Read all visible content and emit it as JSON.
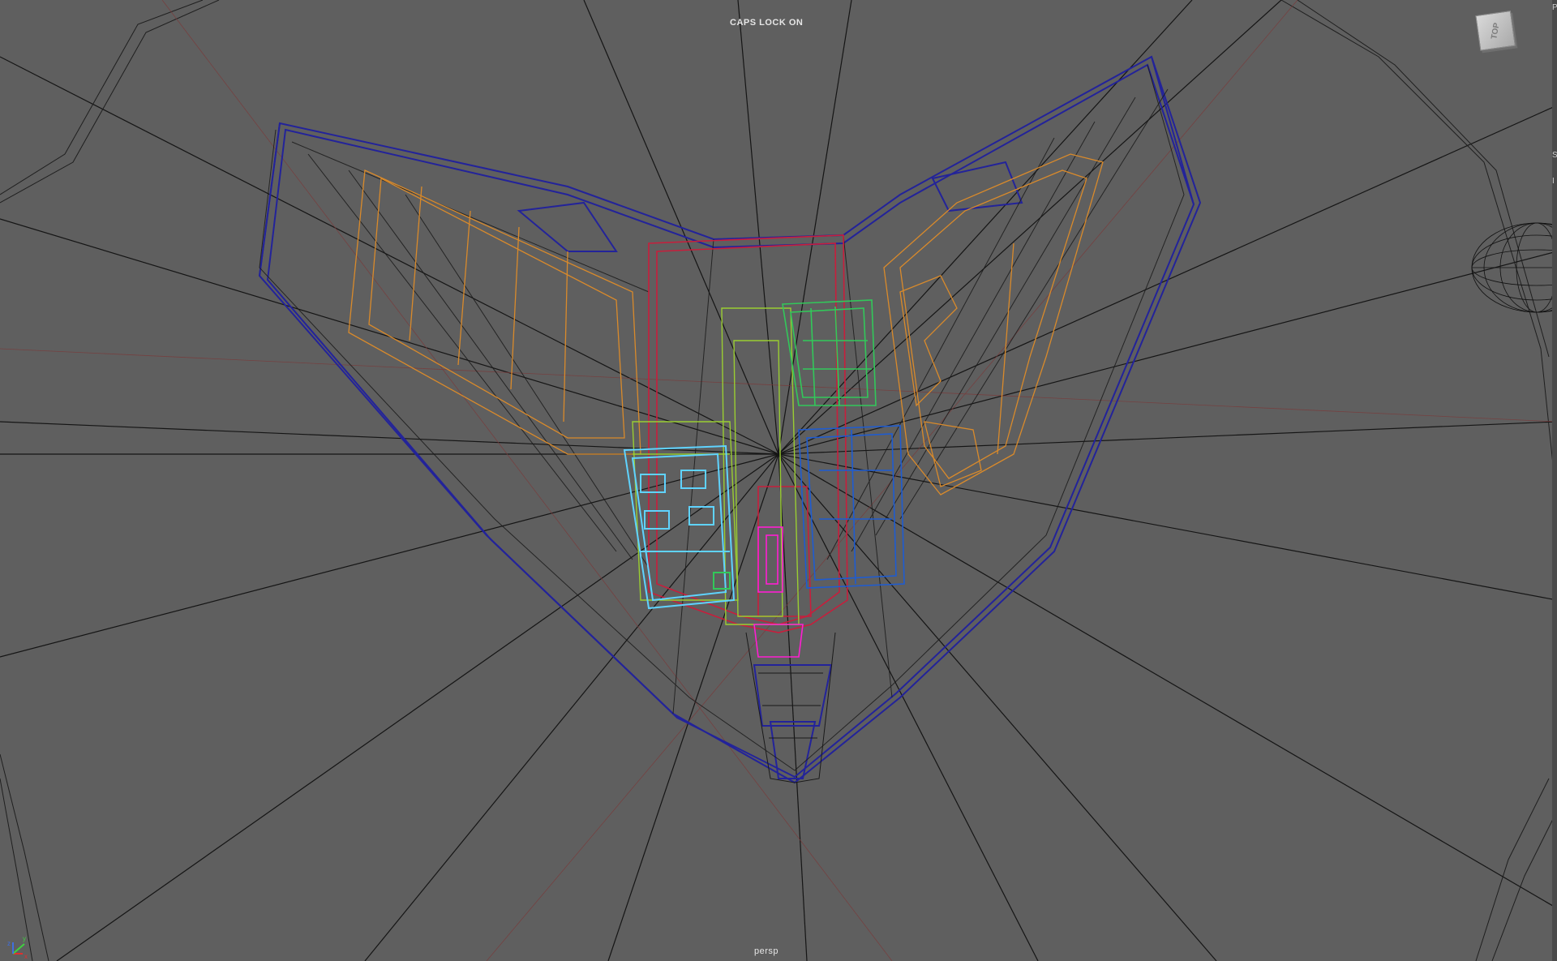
{
  "viewport": {
    "camera": "persp",
    "status_message": "CAPS LOCK ON",
    "view_cube_label": "TOP",
    "axis_labels": {
      "x": "x",
      "y": "y",
      "z": "z"
    },
    "edge_letters": [
      "P",
      "S",
      "I"
    ]
  },
  "colors": {
    "background": "#5f5f5f",
    "grid_lines": "#1a1a1a",
    "outer_hull": "#1e1e8c",
    "cockpit": "#c81e3c",
    "left_frame": "#d98a2b",
    "right_frame": "#d98a2b",
    "hydraulics": "#9acd32",
    "selected_box": "#5fd3ff",
    "core_green": "#32c85a",
    "core_blue": "#1e5cd2",
    "core_magenta": "#ff1ed2"
  }
}
